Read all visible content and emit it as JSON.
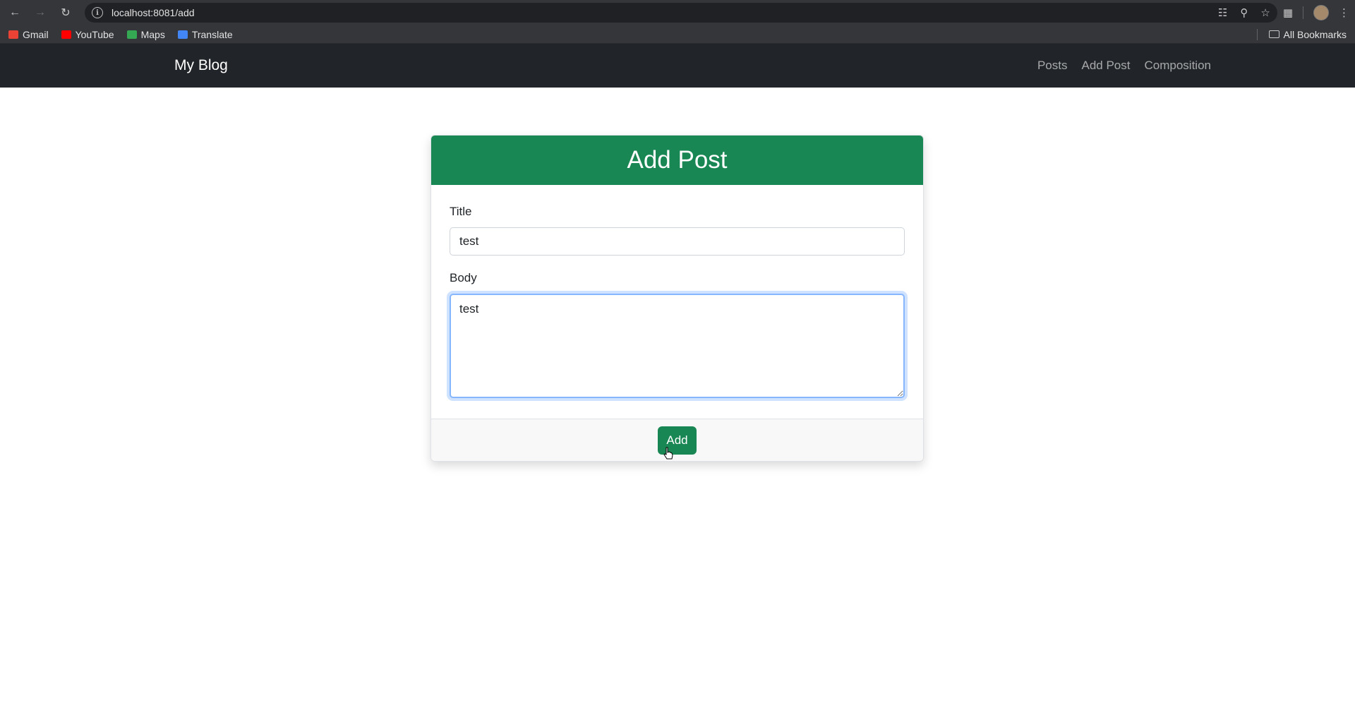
{
  "browser": {
    "url": "localhost:8081/add",
    "bookmarks": [
      {
        "label": "Gmail",
        "color": "#ea4335"
      },
      {
        "label": "YouTube",
        "color": "#ff0000"
      },
      {
        "label": "Maps",
        "color": "#34a853"
      },
      {
        "label": "Translate",
        "color": "#4285f4"
      }
    ],
    "all_bookmarks_label": "All Bookmarks"
  },
  "navbar": {
    "brand": "My Blog",
    "links": [
      "Posts",
      "Add Post",
      "Composition"
    ]
  },
  "form": {
    "header": "Add Post",
    "title_label": "Title",
    "title_value": "test",
    "body_label": "Body",
    "body_value": "test",
    "submit_label": "Add"
  },
  "colors": {
    "accent": "#198754",
    "navbar_bg": "#212529"
  }
}
